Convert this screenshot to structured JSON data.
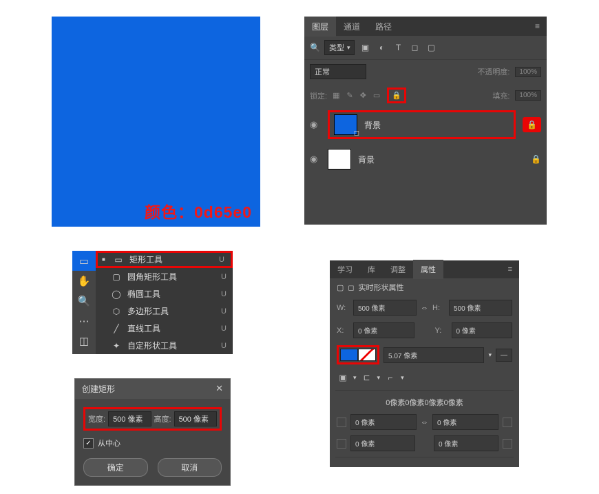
{
  "canvas": {
    "color_label": "颜色：0d65e0"
  },
  "layers": {
    "tabs": {
      "layers": "图层",
      "channels": "通道",
      "paths": "路径"
    },
    "filter_label": "类型",
    "blend": {
      "mode": "正常",
      "opacity_label": "不透明度:",
      "opacity_value": "100%"
    },
    "lock": {
      "label": "锁定:",
      "fill_label": "填充:",
      "fill_value": "100%"
    },
    "rows": [
      {
        "name": "背景"
      },
      {
        "name": "背景"
      }
    ]
  },
  "tools": {
    "items": [
      {
        "label": "矩形工具",
        "key": "U",
        "active": true
      },
      {
        "label": "圆角矩形工具",
        "key": "U"
      },
      {
        "label": "椭圆工具",
        "key": "U"
      },
      {
        "label": "多边形工具",
        "key": "U"
      },
      {
        "label": "直线工具",
        "key": "U"
      },
      {
        "label": "自定形状工具",
        "key": "U"
      }
    ]
  },
  "dialog": {
    "title": "创建矩形",
    "width_label": "宽度:",
    "width_value": "500 像素",
    "height_label": "高度:",
    "height_value": "500 像素",
    "from_center": "从中心",
    "ok": "确定",
    "cancel": "取消"
  },
  "props": {
    "tabs": {
      "learn": "学习",
      "lib": "库",
      "adjust": "调整",
      "properties": "属性"
    },
    "title": "实时形状属性",
    "w_label": "W:",
    "w_value": "500 像素",
    "h_label": "H:",
    "h_value": "500 像素",
    "x_label": "X:",
    "x_value": "0 像素",
    "y_label": "Y:",
    "y_value": "0 像素",
    "stroke_value": "5.07 像素",
    "corner_summary": "0像素0像素0像素0像素",
    "corner_val": "0 像素"
  }
}
